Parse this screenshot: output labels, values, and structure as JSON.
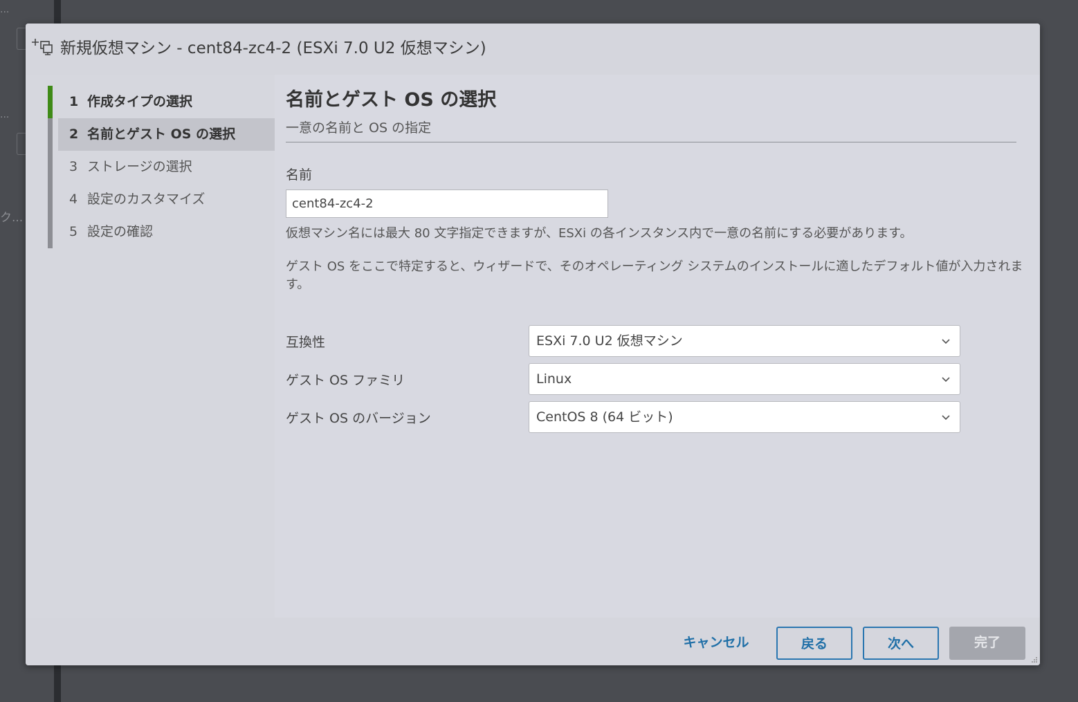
{
  "background": {
    "frag_top": "...",
    "frag_mid": "...",
    "frag_left": "ク..."
  },
  "dialog": {
    "title": "新規仮想マシン - cent84-zc4-2 (ESXi 7.0 U2 仮想マシン)"
  },
  "steps": [
    {
      "num": "1",
      "label": "作成タイプの選択",
      "state": "done"
    },
    {
      "num": "2",
      "label": "名前とゲスト OS の選択",
      "state": "active"
    },
    {
      "num": "3",
      "label": "ストレージの選択",
      "state": "pending"
    },
    {
      "num": "4",
      "label": "設定のカスタマイズ",
      "state": "pending"
    },
    {
      "num": "5",
      "label": "設定の確認",
      "state": "pending"
    }
  ],
  "page": {
    "title": "名前とゲスト OS の選択",
    "subtitle": "一意の名前と OS の指定"
  },
  "form": {
    "name_label": "名前",
    "name_value": "cent84-zc4-2",
    "name_help": "仮想マシン名には最大 80 文字指定できますが、ESXi の各インスタンス内で一意の名前にする必要があります。",
    "guest_help": "ゲスト OS をここで特定すると、ウィザードで、そのオペレーティング システムのインストールに適したデフォルト値が入力されます。",
    "compat_label": "互換性",
    "compat_value": "ESXi 7.0 U2 仮想マシン",
    "family_label": "ゲスト OS ファミリ",
    "family_value": "Linux",
    "version_label": "ゲスト OS のバージョン",
    "version_value": "CentOS 8 (64 ビット)"
  },
  "footer": {
    "cancel": "キャンセル",
    "back": "戻る",
    "next": "次へ",
    "finish": "完了"
  },
  "colors": {
    "accent": "#1f6fa7",
    "done_step": "#3f8a17",
    "disabled_button": "#a4a6ad"
  },
  "icons": {
    "header": "new-vm-icon",
    "select": "chevron-down-icon"
  }
}
